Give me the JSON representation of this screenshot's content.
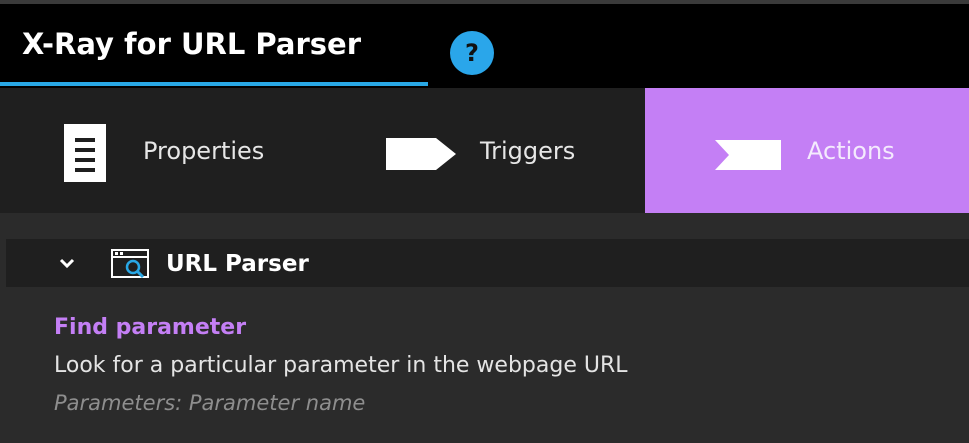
{
  "header": {
    "title": "X-Ray for URL Parser",
    "help_icon": "question-icon",
    "help_glyph": "?",
    "accent_color": "#29a8e6"
  },
  "tabs": [
    {
      "label": "Properties",
      "icon": "document-icon",
      "active": false
    },
    {
      "label": "Triggers",
      "icon": "trigger-arrow-icon",
      "active": false
    },
    {
      "label": "Actions",
      "icon": "action-notch-icon",
      "active": true
    }
  ],
  "active_tab_color": "#c47ff5",
  "group": {
    "label": "URL Parser",
    "icon": "url-inspect-icon",
    "expanded": true,
    "expand_icon": "chevron-down-icon"
  },
  "actions": [
    {
      "title": "Find parameter",
      "description": "Look for a particular parameter in the webpage URL",
      "params": "Parameters: Parameter name"
    }
  ]
}
